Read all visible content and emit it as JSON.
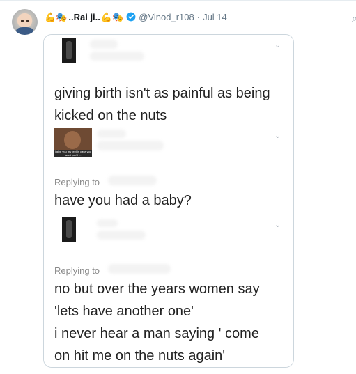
{
  "tweet": {
    "emoji_left": "💪🎭",
    "name": "..Rai ji..",
    "emoji_right": "💪🎭",
    "handle": "@Vinod_r108",
    "separator": "·",
    "date": "Jul 14"
  },
  "screenshot": {
    "post1": "giving birth isn't as painful as being kicked on the nuts",
    "meme_caption": "i give you my text in case you want you'll ...",
    "reply1_label": "Replying to",
    "post2": "have you had a baby?",
    "reply2_label": "Replying to",
    "post3_lines": [
      "no but over the years women say",
      "'lets have another one'",
      "i never hear a man saying ' come",
      "on hit me on the nuts again'"
    ]
  },
  "icons": {
    "verified": "verified-badge-icon",
    "more": "more-icon",
    "chevron": "chevron-down-icon"
  },
  "colors": {
    "verified_blue": "#1da1f2",
    "meta_gray": "#657786",
    "border": "#ccd6dd"
  }
}
